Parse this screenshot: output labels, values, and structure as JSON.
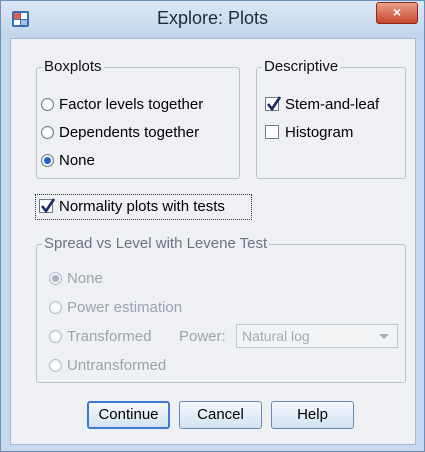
{
  "window": {
    "title": "Explore: Plots",
    "close_label": "×"
  },
  "boxplots": {
    "legend": "Boxplots",
    "options": [
      {
        "label": "Factor levels together",
        "selected": false
      },
      {
        "label": "Dependents together",
        "selected": false
      },
      {
        "label": "None",
        "selected": true
      }
    ]
  },
  "descriptive": {
    "legend": "Descriptive",
    "options": [
      {
        "label": "Stem-and-leaf",
        "checked": true
      },
      {
        "label": "Histogram",
        "checked": false
      }
    ]
  },
  "normality": {
    "label": "Normality plots with tests",
    "checked": true
  },
  "spread": {
    "legend": "Spread vs Level with Levene Test",
    "options": [
      {
        "label": "None",
        "selected": true
      },
      {
        "label": "Power estimation",
        "selected": false
      },
      {
        "label": "Transformed",
        "selected": false
      },
      {
        "label": "Untransformed",
        "selected": false
      }
    ],
    "power_label": "Power:",
    "power_value": "Natural log",
    "enabled": false
  },
  "buttons": {
    "continue": "Continue",
    "cancel": "Cancel",
    "help": "Help"
  },
  "colors": {
    "title_bar": "#c7d8ee",
    "close_button": "#c9452b",
    "radio_selected": "#1f64c9",
    "disabled_text": "#9ba4ad"
  }
}
